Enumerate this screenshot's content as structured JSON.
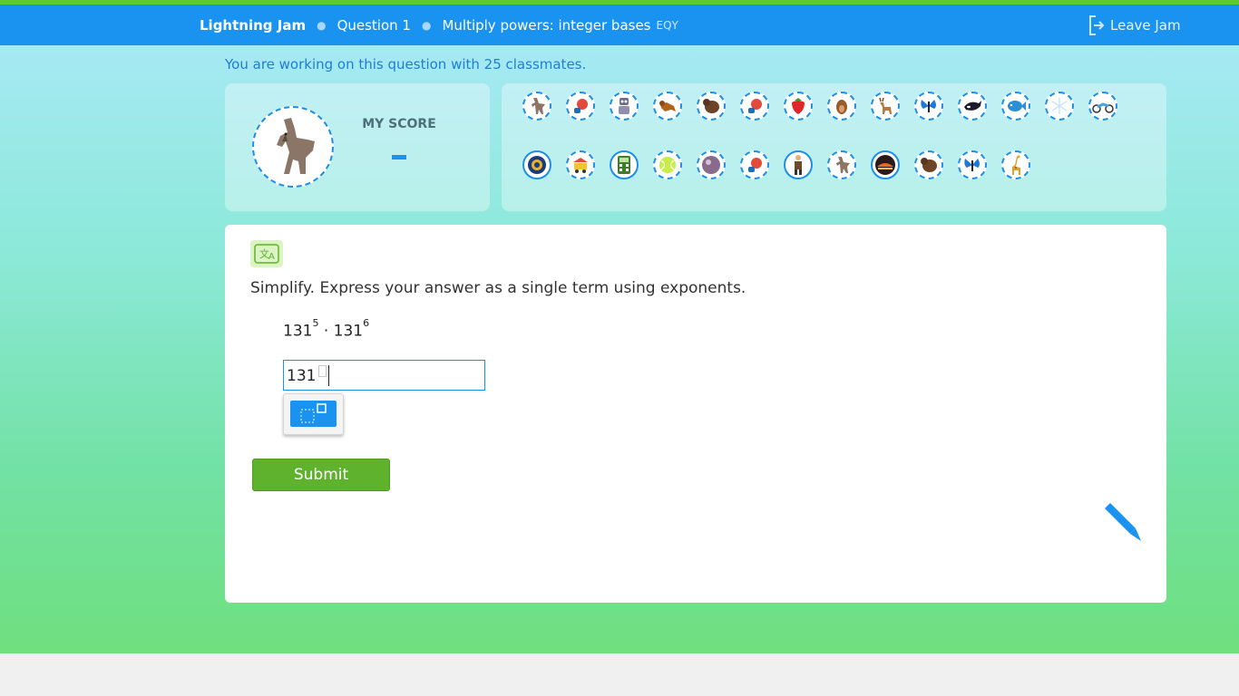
{
  "header": {
    "brand": "Lightning Jam",
    "question": "Question 1",
    "skill": "Multiply powers: integer bases",
    "skill_code": "EQY",
    "leave_label": "Leave Jam"
  },
  "notice": "You are working on this question with 25 classmates.",
  "score": {
    "label": "MY SCORE",
    "value": ""
  },
  "classmates": [
    "wolf-icon",
    "boxing-glove-icon",
    "robot-icon",
    "monkey-icon",
    "bear-icon",
    "boxing-glove-icon",
    "strawberry-icon",
    "otter-icon",
    "deer-icon",
    "butterfly-icon",
    "orca-icon",
    "fish-icon",
    "snowflake-icon",
    "motorcycle-icon",
    "badge-icon",
    "cart-icon",
    "calculator-icon",
    "tennis-ball-icon",
    "planet-icon",
    "boxing-glove-icon",
    "explorer-icon",
    "wolf-icon",
    "sunset-icon",
    "bear-icon",
    "butterfly-icon",
    "giraffe-icon"
  ],
  "question": {
    "prompt": "Simplify. Express your answer as a single term using exponents.",
    "base1": "131",
    "exp1": "5",
    "operator": "·",
    "base2": "131",
    "exp2": "6",
    "answer_base": "131"
  },
  "submit_label": "Submit",
  "colors": {
    "header": "#1a93f0",
    "accent_green": "#5fb22c",
    "stripe": "#5fcc2e"
  }
}
